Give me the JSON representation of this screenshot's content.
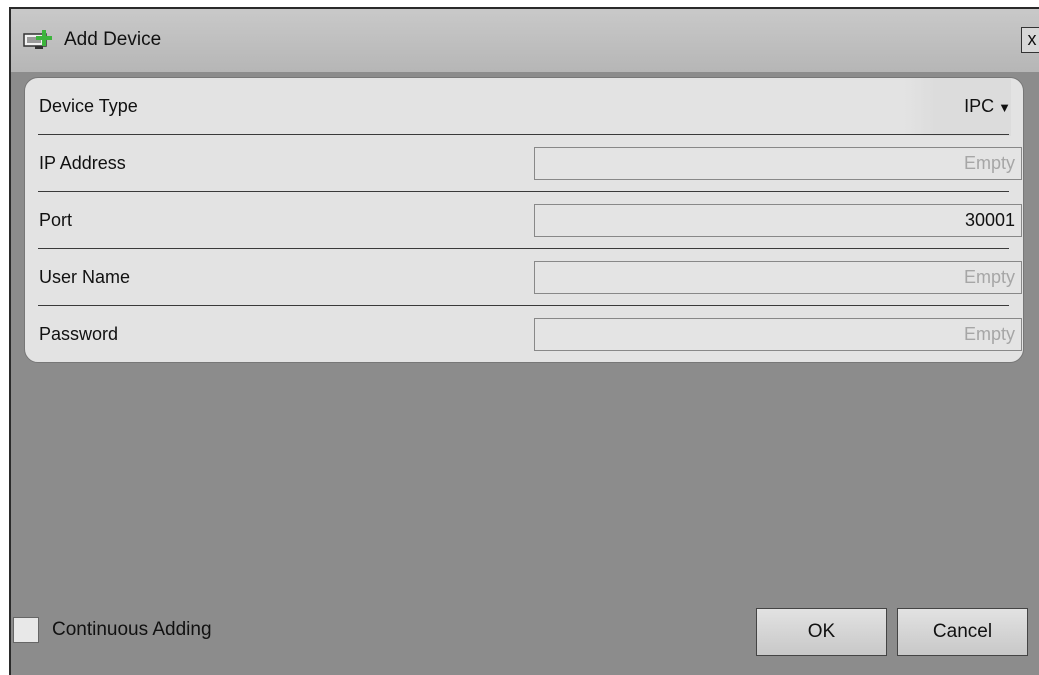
{
  "dialog": {
    "title": "Add Device",
    "close_glyph": "x",
    "title_icon": "add-device-icon"
  },
  "form": {
    "device_type": {
      "label": "Device Type",
      "value": "IPC",
      "caret": "▼"
    },
    "ip_address": {
      "label": "IP Address",
      "placeholder": "Empty",
      "value": ""
    },
    "port": {
      "label": "Port",
      "value": "30001"
    },
    "user_name": {
      "label": "User Name",
      "placeholder": "Empty",
      "value": ""
    },
    "password": {
      "label": "Password",
      "placeholder": "Empty",
      "value": ""
    }
  },
  "footer": {
    "continuous_adding_label": "Continuous Adding",
    "continuous_adding_checked": false,
    "ok_label": "OK",
    "cancel_label": "Cancel"
  },
  "colors": {
    "background": "#8a8a8a",
    "panel": "#e3e3e3",
    "titlebar": "#c0c0c0",
    "icon_green": "#3cb43c"
  }
}
